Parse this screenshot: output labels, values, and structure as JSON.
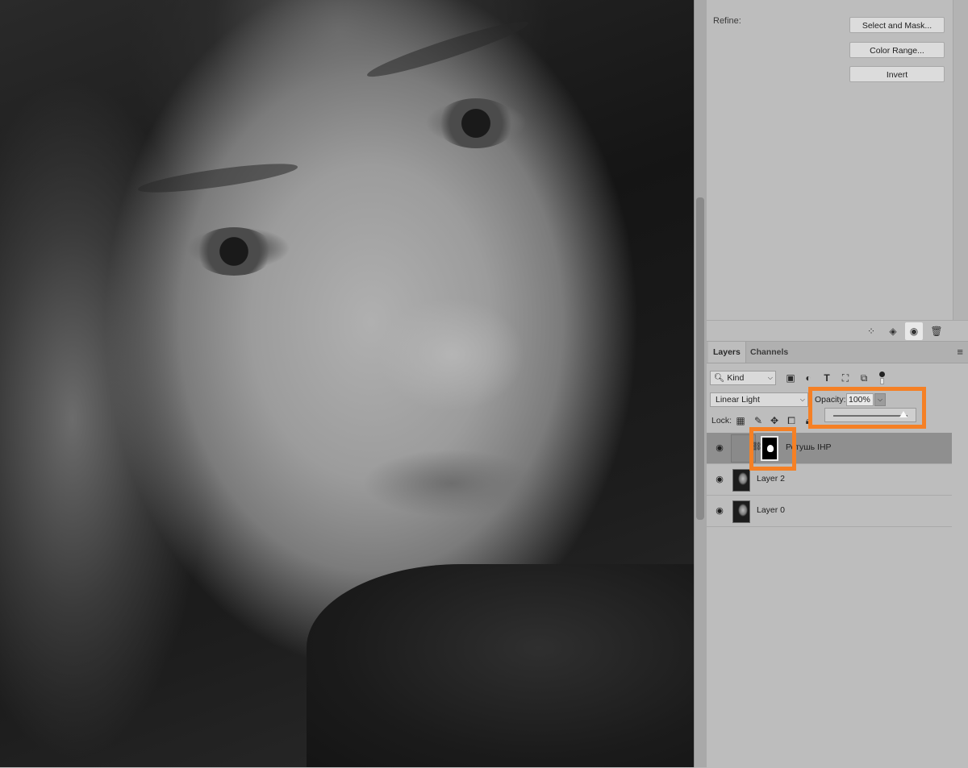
{
  "properties": {
    "refine_label": "Refine:",
    "buttons": {
      "select_and_mask": "Select and Mask...",
      "color_range": "Color Range...",
      "invert": "Invert"
    },
    "footer_icons": [
      "selection-from-mask-icon",
      "apply-mask-icon",
      "visibility-icon",
      "delete-icon"
    ]
  },
  "layers_panel": {
    "tabs": {
      "layers": "Layers",
      "channels": "Channels"
    },
    "menu_glyph": "≡",
    "filter": {
      "kind_label": "Kind",
      "icons": [
        "pixel-filter-icon",
        "adjustment-filter-icon",
        "type-filter-icon",
        "shape-filter-icon",
        "smart-object-filter-icon"
      ]
    },
    "blend_mode": "Linear Light",
    "opacity_label": "Opacity:",
    "opacity_value": "100%",
    "opacity_slider_fraction": 1.0,
    "lock_label": "Lock:",
    "lock_icons": [
      "lock-transparent-icon",
      "lock-image-icon",
      "lock-position-icon",
      "lock-artboard-icon",
      "lock-all-icon"
    ],
    "layers": [
      {
        "name": "Ретушь IHP",
        "selected": true,
        "type": "adjustment-with-mask"
      },
      {
        "name": "Layer 2",
        "selected": false,
        "type": "pixel"
      },
      {
        "name": "Layer 0",
        "selected": false,
        "type": "pixel"
      }
    ]
  },
  "highlight_color": "#f58025"
}
